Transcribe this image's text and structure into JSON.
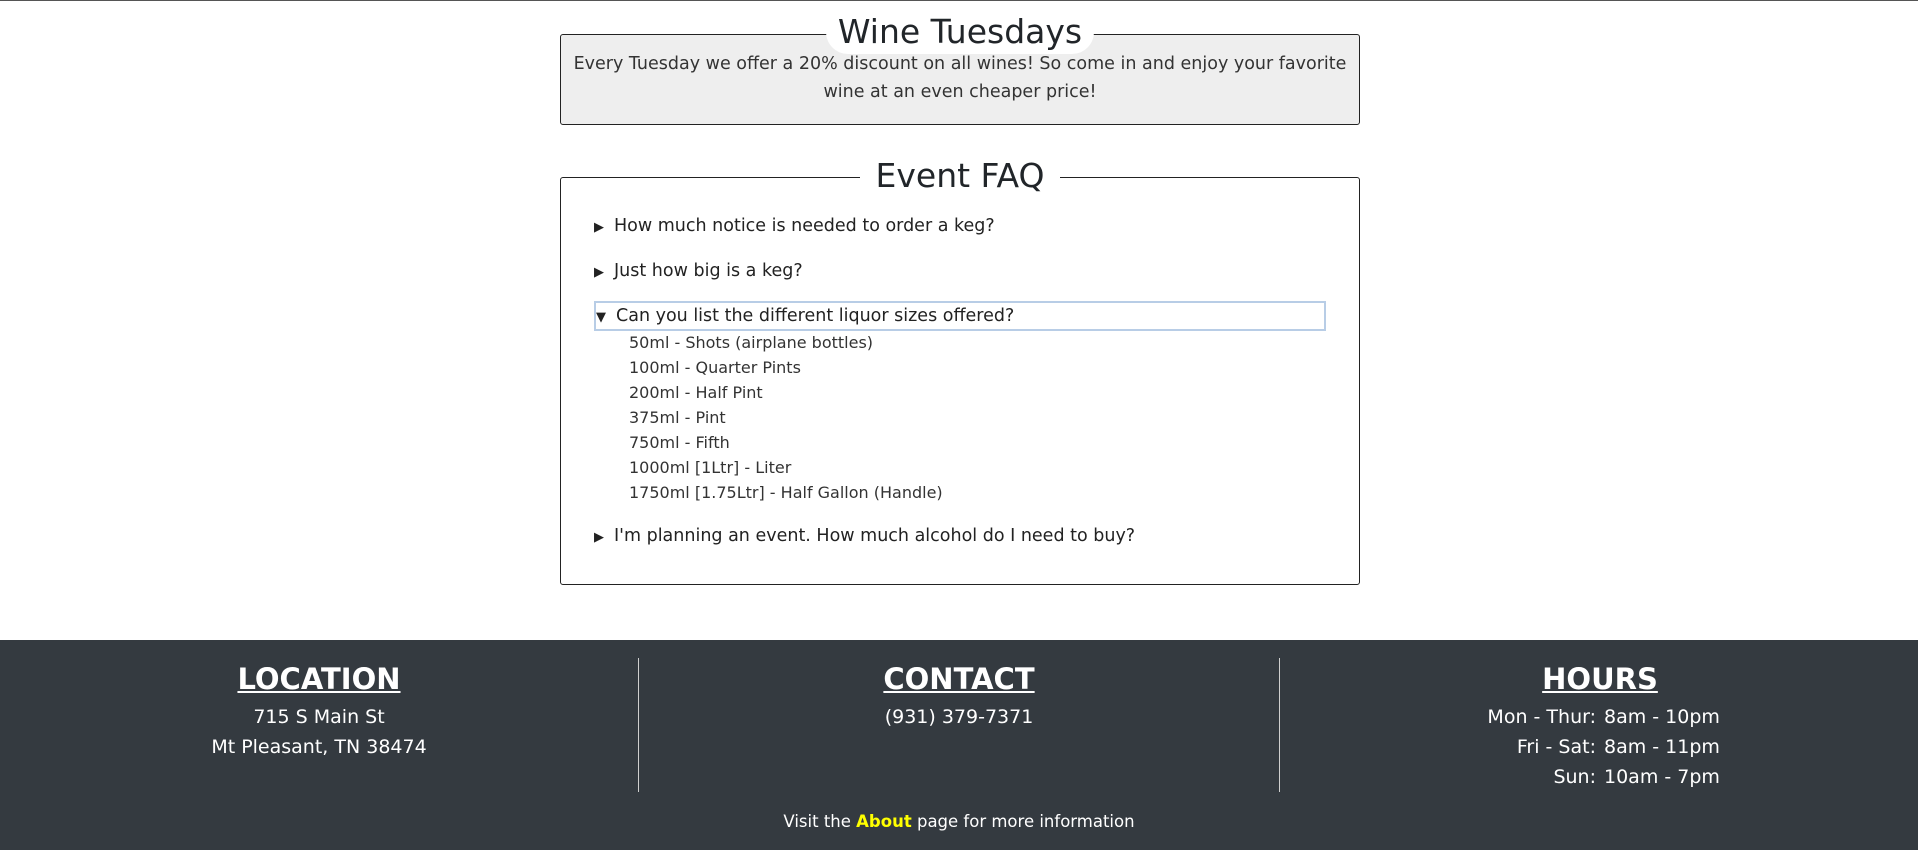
{
  "wine": {
    "title": "Wine Tuesdays",
    "text": "Every Tuesday we offer a 20% discount on all wines! So come in and enjoy your favorite wine at an even cheaper price!"
  },
  "faq": {
    "title": "Event FAQ",
    "questions": [
      {
        "label": "How much notice is needed to order a keg?",
        "open": false
      },
      {
        "label": "Just how big is a keg?",
        "open": false
      },
      {
        "label": "Can you list the different liquor sizes offered?",
        "open": true
      },
      {
        "label": "I'm planning an event. How much alcohol do I need to buy?",
        "open": false
      }
    ],
    "sizes": [
      "50ml - Shots (airplane bottles)",
      "100ml - Quarter Pints",
      "200ml - Half Pint",
      "375ml - Pint",
      "750ml - Fifth",
      "1000ml [1Ltr] - Liter",
      "1750ml [1.75Ltr] - Half Gallon (Handle)"
    ],
    "closed_marker": "▶",
    "open_marker": "▼"
  },
  "footer": {
    "location": {
      "heading": "LOCATION",
      "line1": "715 S Main St",
      "line2": "Mt Pleasant, TN 38474"
    },
    "contact": {
      "heading": "CONTACT",
      "phone": "(931) 379-7371"
    },
    "hours": {
      "heading": "HOURS",
      "rows": [
        {
          "days": "Mon - Thur:",
          "time": "8am - 10pm"
        },
        {
          "days": "Fri - Sat:",
          "time": "8am - 11pm"
        },
        {
          "days": "Sun:",
          "time": "10am - 7pm"
        }
      ]
    },
    "visit": {
      "prefix": "Visit the",
      "link": "About",
      "suffix": "page for more information"
    },
    "colors": {
      "background": "#343a40",
      "link": "#ffff00"
    }
  }
}
